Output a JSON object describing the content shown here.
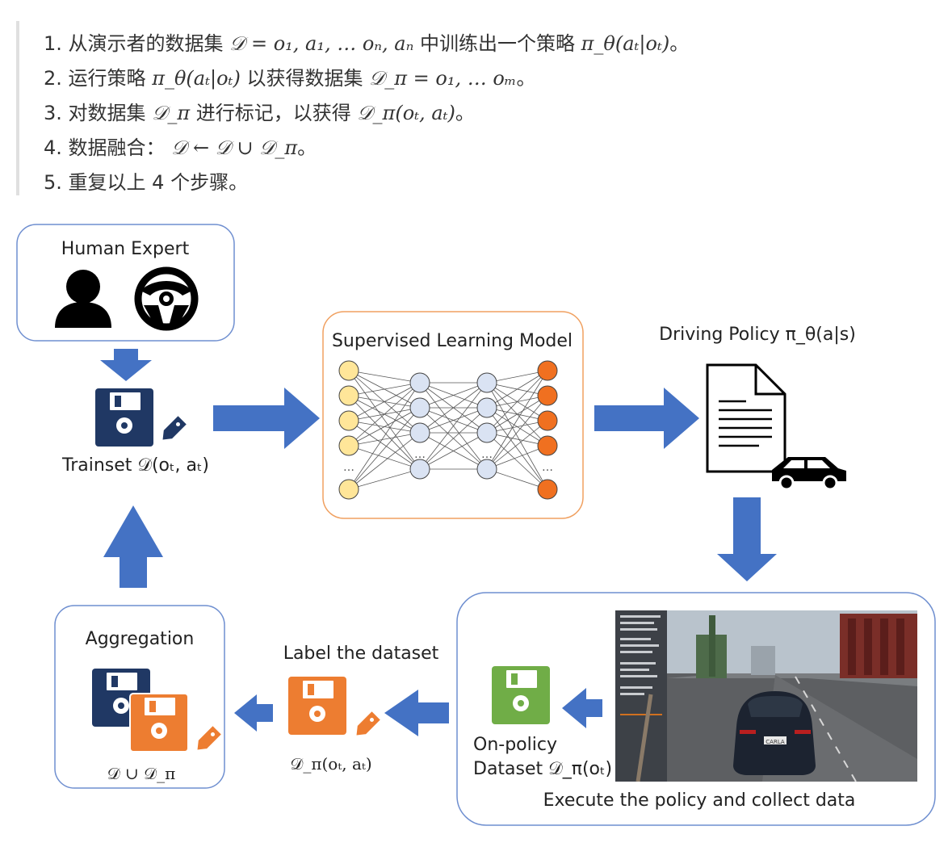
{
  "steps": [
    {
      "num": "1.",
      "pre": "从演示者的数据集",
      "math1": "𝒟 = o₁, a₁, … oₙ, aₙ",
      "mid": "中训练出一个策略",
      "math2": "π_θ(aₜ|oₜ)",
      "post": "。"
    },
    {
      "num": "2.",
      "pre": "运行策略",
      "math1": "π_θ(aₜ|oₜ)",
      "mid": "以获得数据集",
      "math2": "𝒟_π = o₁, … oₘ",
      "post": "。"
    },
    {
      "num": "3.",
      "pre": "对数据集",
      "math1": "𝒟_π",
      "mid": "进行标记，以获得",
      "math2": "𝒟_π(oₜ, aₜ)",
      "post": "。"
    },
    {
      "num": "4.",
      "pre": "数据融合：",
      "math1": "𝒟 ← 𝒟 ∪ 𝒟_π",
      "mid": "",
      "math2": "",
      "post": "。"
    },
    {
      "num": "5.",
      "pre": "重复以上 4 个步骤。",
      "math1": "",
      "mid": "",
      "math2": "",
      "post": ""
    }
  ],
  "diagram": {
    "human_expert": "Human Expert",
    "trainset": "Trainset 𝒟(oₜ, aₜ)",
    "supervised_model": "Supervised Learning Model",
    "driving_policy": "Driving Policy π_θ(a|s)",
    "aggregation": "Aggregation",
    "aggregation_formula": "𝒟 ∪ 𝒟_π",
    "label_dataset": "Label the dataset",
    "label_formula": "𝒟_π(oₜ, aₜ)",
    "onpolicy_line1": "On-policy",
    "onpolicy_line2": "Dataset 𝒟_π(oₜ)",
    "execute": "Execute the policy and collect data",
    "ellipsis": "…",
    "plate_text": "CARLA"
  },
  "colors": {
    "arrow_blue": "#4472c4",
    "box_blue_border": "#6f8fd0",
    "box_orange_border": "#f0a060",
    "disk_navy": "#203864",
    "disk_orange": "#ed7d31",
    "disk_green": "#70ad47",
    "node_yellow": "#ffe699",
    "node_blue": "#dae3f3",
    "node_orange": "#f07020"
  }
}
